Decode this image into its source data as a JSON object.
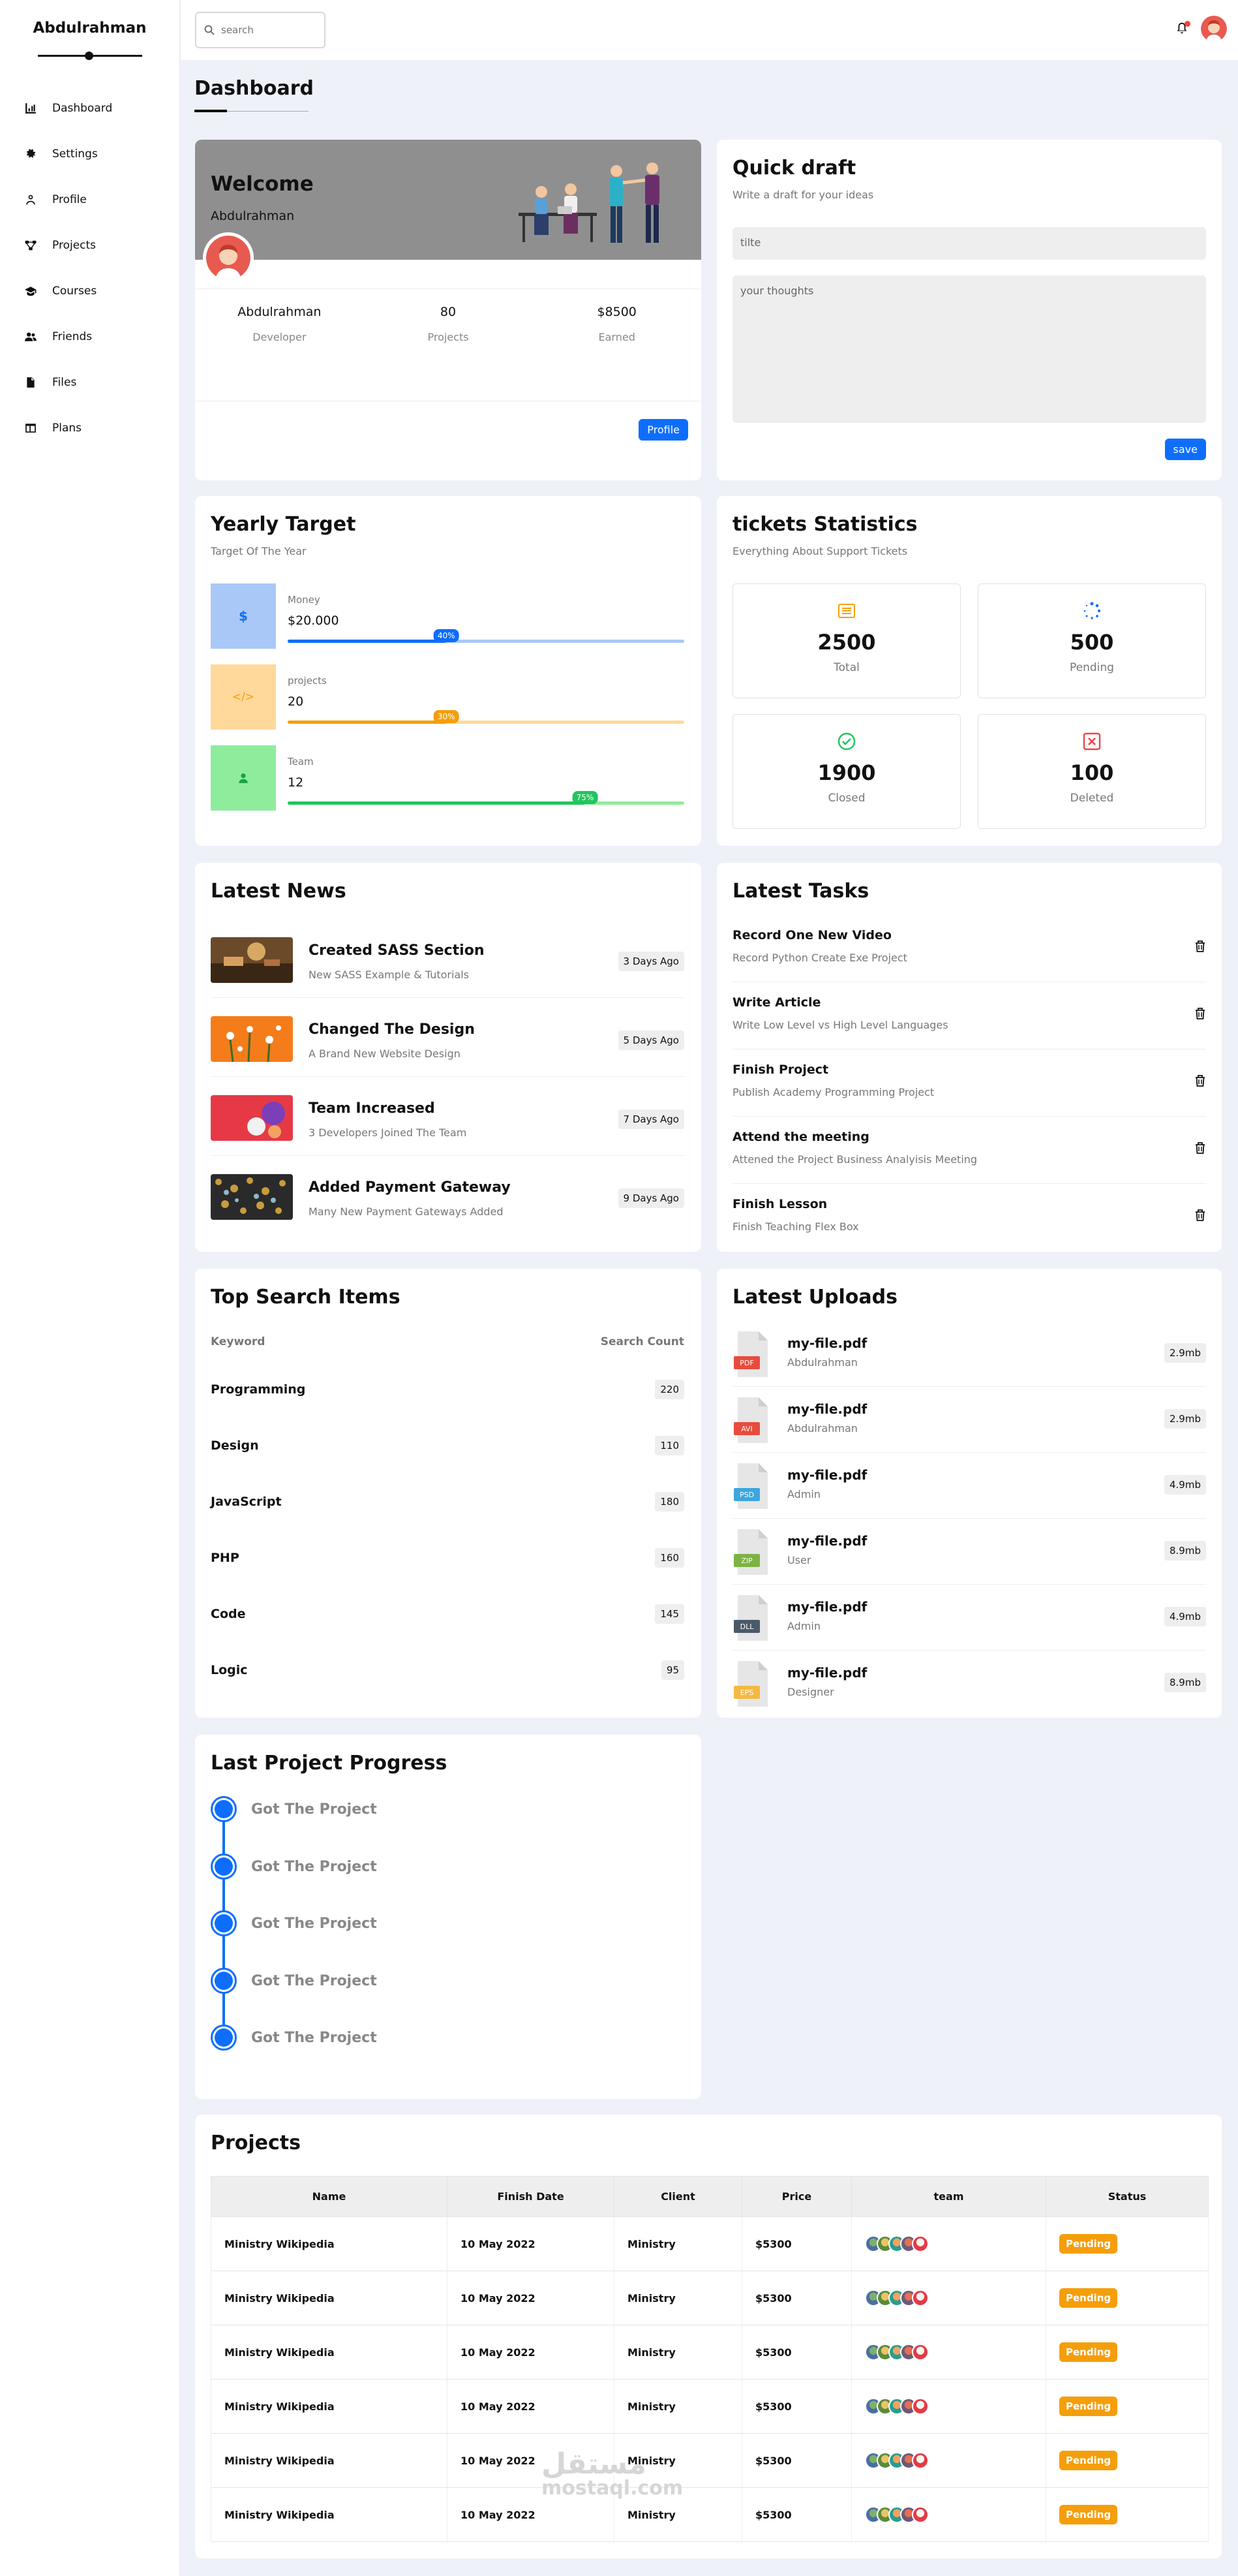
{
  "sidebar": {
    "brand": "Abdulrahman",
    "items": [
      {
        "label": "Dashboard",
        "icon": "chart-icon"
      },
      {
        "label": "Settings",
        "icon": "gear-icon"
      },
      {
        "label": "Profile",
        "icon": "user-icon"
      },
      {
        "label": "Projects",
        "icon": "diagram-icon"
      },
      {
        "label": "Courses",
        "icon": "graduation-cap-icon"
      },
      {
        "label": "Friends",
        "icon": "users-icon"
      },
      {
        "label": "Files",
        "icon": "file-icon"
      },
      {
        "label": "Plans",
        "icon": "table-icon"
      }
    ]
  },
  "topbar": {
    "search_placeholder": "search"
  },
  "page_title": "Dashboard",
  "welcome": {
    "title": "Welcome",
    "name": "Abdulrahman",
    "stats": [
      {
        "value": "Abdulrahman",
        "label": "Developer"
      },
      {
        "value": "80",
        "label": "Projects"
      },
      {
        "value": "$8500",
        "label": "Earned"
      }
    ],
    "button": "Profile"
  },
  "quick_draft": {
    "title": "Quick draft",
    "subtitle": "Write a draft for your ideas",
    "title_placeholder": "tilte",
    "body_placeholder": "your thoughts",
    "button": "save"
  },
  "yearly_target": {
    "title": "Yearly Target",
    "subtitle": "Target Of The Year",
    "rows": [
      {
        "label": "Money",
        "value": "$20.000",
        "percent": 40,
        "badge": "40%",
        "color": "#0d6efd",
        "bg": "#aac8f7",
        "icon": "$"
      },
      {
        "label": "projects",
        "value": "20",
        "percent": 40,
        "badge": "30%",
        "color": "#f59e0b",
        "bg": "#ffd99b",
        "icon": "</>"
      },
      {
        "label": "Team",
        "value": "12",
        "percent": 75,
        "badge": "75%",
        "color": "#22c55e",
        "bg": "#8eed9d",
        "icon": "person"
      }
    ]
  },
  "tickets": {
    "title": "tickets Statistics",
    "subtitle": "Everything About Support Tickets",
    "items": [
      {
        "value": "2500",
        "label": "Total",
        "icon": "list-icon",
        "color": "#f59e0b"
      },
      {
        "value": "500",
        "label": "Pending",
        "icon": "spinner-icon",
        "color": "#0d6efd"
      },
      {
        "value": "1900",
        "label": "Closed",
        "icon": "check-circle-icon",
        "color": "#22c55e"
      },
      {
        "value": "100",
        "label": "Deleted",
        "icon": "x-box-icon",
        "color": "#ef4444"
      }
    ]
  },
  "news": {
    "title": "Latest News",
    "items": [
      {
        "title": "Created SASS Section",
        "desc": "New SASS Example & Tutorials",
        "ago": "3 Days Ago"
      },
      {
        "title": "Changed The Design",
        "desc": "A Brand New Website Design",
        "ago": "5 Days Ago"
      },
      {
        "title": "Team Increased",
        "desc": "3 Developers Joined The Team",
        "ago": "7 Days Ago"
      },
      {
        "title": "Added Payment Gateway",
        "desc": "Many New Payment Gateways Added",
        "ago": "9 Days Ago"
      }
    ]
  },
  "tasks": {
    "title": "Latest Tasks",
    "items": [
      {
        "title": "Record One New Video",
        "desc": "Record Python Create Exe Project"
      },
      {
        "title": "Write Article",
        "desc": "Write Low Level vs High Level Languages"
      },
      {
        "title": "Finish Project",
        "desc": "Publish Academy Programming Project"
      },
      {
        "title": "Attend the meeting",
        "desc": "Attened the Project Business Analyisis Meeting"
      },
      {
        "title": "Finish Lesson",
        "desc": "Finish Teaching Flex Box"
      }
    ]
  },
  "top_search": {
    "title": "Top Search Items",
    "col_keyword": "Keyword",
    "col_count": "Search Count",
    "rows": [
      {
        "keyword": "Programming",
        "count": "220"
      },
      {
        "keyword": "Design",
        "count": "110"
      },
      {
        "keyword": "JavaScript",
        "count": "180"
      },
      {
        "keyword": "PHP",
        "count": "160"
      },
      {
        "keyword": "Code",
        "count": "145"
      },
      {
        "keyword": "Logic",
        "count": "95"
      }
    ]
  },
  "uploads": {
    "title": "Latest Uploads",
    "items": [
      {
        "name": "my-file.pdf",
        "who": "Abdulrahman",
        "size": "2.9mb",
        "ext": "PDF",
        "color": "#e74c3c"
      },
      {
        "name": "my-file.pdf",
        "who": "Abdulrahman",
        "size": "2.9mb",
        "ext": "AVI",
        "color": "#e74c3c"
      },
      {
        "name": "my-file.pdf",
        "who": "Admin",
        "size": "4.9mb",
        "ext": "PSD",
        "color": "#3ba6df"
      },
      {
        "name": "my-file.pdf",
        "who": "User",
        "size": "8.9mb",
        "ext": "ZIP",
        "color": "#7cb342"
      },
      {
        "name": "my-file.pdf",
        "who": "Admin",
        "size": "4.9mb",
        "ext": "DLL",
        "color": "#4a5a6a"
      },
      {
        "name": "my-file.pdf",
        "who": "Designer",
        "size": "8.9mb",
        "ext": "EPS",
        "color": "#f5b942"
      }
    ]
  },
  "progress": {
    "title": "Last Project Progress",
    "items": [
      "Got The Project",
      "Got The Project",
      "Got The Project",
      "Got The Project",
      "Got The Project"
    ]
  },
  "projects": {
    "title": "Projects",
    "columns": [
      "Name",
      "Finish Date",
      "Client",
      "Price",
      "team",
      "Status"
    ],
    "rows": [
      {
        "name": "Ministry Wikipedia",
        "date": "10 May 2022",
        "client": "Ministry",
        "price": "$5300",
        "status": "Pending"
      },
      {
        "name": "Ministry Wikipedia",
        "date": "10 May 2022",
        "client": "Ministry",
        "price": "$5300",
        "status": "Pending"
      },
      {
        "name": "Ministry Wikipedia",
        "date": "10 May 2022",
        "client": "Ministry",
        "price": "$5300",
        "status": "Pending"
      },
      {
        "name": "Ministry Wikipedia",
        "date": "10 May 2022",
        "client": "Ministry",
        "price": "$5300",
        "status": "Pending"
      },
      {
        "name": "Ministry Wikipedia",
        "date": "10 May 2022",
        "client": "Ministry",
        "price": "$5300",
        "status": "Pending"
      },
      {
        "name": "Ministry Wikipedia",
        "date": "10 May 2022",
        "client": "Ministry",
        "price": "$5300",
        "status": "Pending"
      }
    ]
  }
}
